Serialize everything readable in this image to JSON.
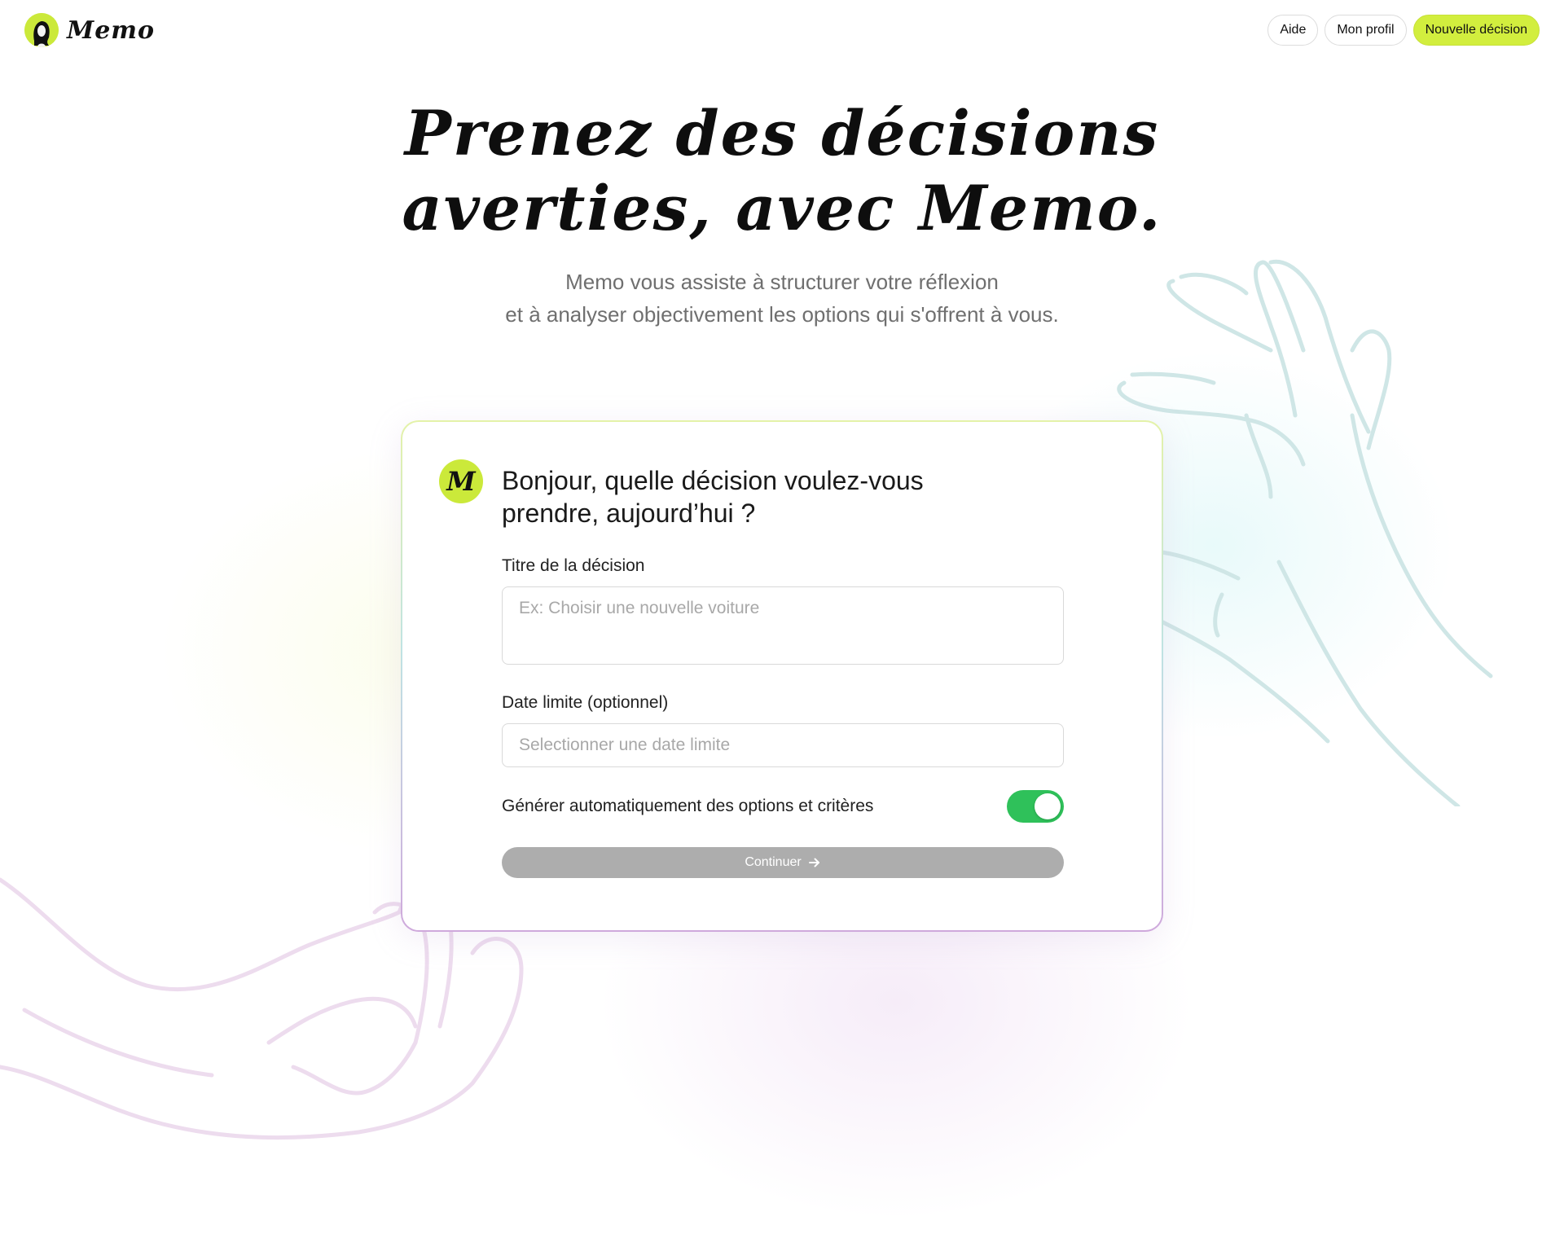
{
  "brand": {
    "name": "Memo",
    "accent_color": "#cbe93a"
  },
  "nav": {
    "help_label": "Aide",
    "profile_label": "Mon profil",
    "new_decision_label": "Nouvelle décision"
  },
  "hero": {
    "title_line1": "Prenez des décisions",
    "title_line2": "averties, avec Memo.",
    "subtitle_line1": "Memo vous assiste à structurer votre réflexion",
    "subtitle_line2": "et à analyser objectivement les options qui s'offrent à vous."
  },
  "card": {
    "avatar_letter": "M",
    "question_line1": "Bonjour, quelle décision voulez-vous",
    "question_line2": "prendre, aujourd’hui ?",
    "title_field": {
      "label": "Titre de la décision",
      "placeholder": "Ex: Choisir une nouvelle voiture",
      "value": ""
    },
    "date_field": {
      "label": "Date limite (optionnel)",
      "placeholder": "Selectionner une date limite",
      "value": ""
    },
    "auto_generate": {
      "label": "Générer automatiquement des options et critères",
      "enabled": true,
      "color": "#2fc15a"
    },
    "continue_label": "Continuer",
    "continue_icon": "arrow-right-icon",
    "continue_color": "#adadad"
  }
}
